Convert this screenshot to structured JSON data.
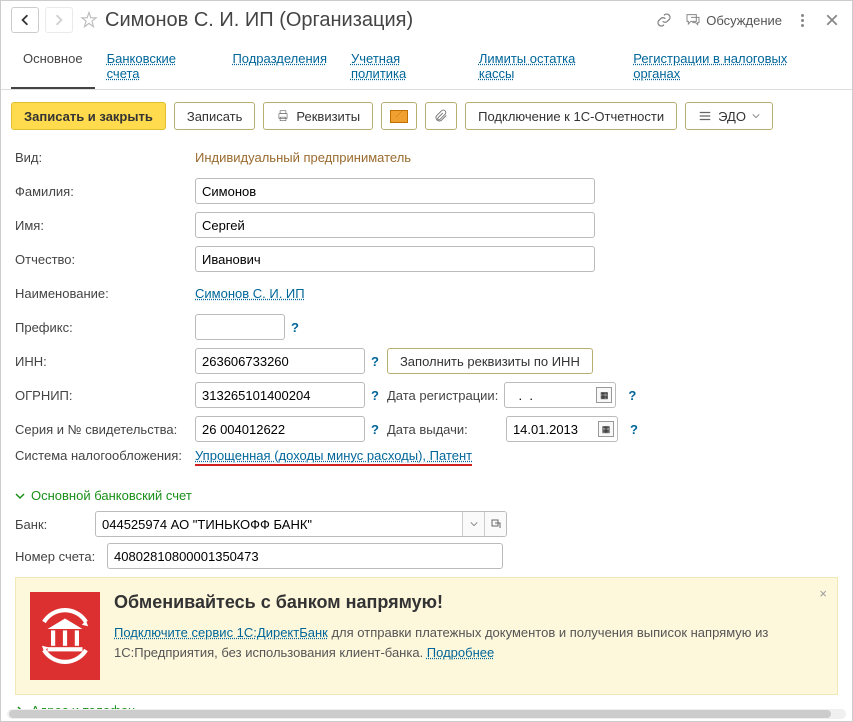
{
  "header": {
    "title": "Симонов С. И. ИП (Организация)",
    "discuss": "Обсуждение"
  },
  "tabs": {
    "main": "Основное",
    "bank": "Банковские счета",
    "dept": "Подразделения",
    "policy": "Учетная политика",
    "limits": "Лимиты остатка кассы",
    "tax": "Регистрации в налоговых органах"
  },
  "toolbar": {
    "save_close": "Записать и закрыть",
    "save": "Записать",
    "requisites": "Реквизиты",
    "connect": "Подключение к 1С-Отчетности",
    "edo": "ЭДО"
  },
  "form": {
    "kind_label": "Вид:",
    "kind_value": "Индивидуальный предприниматель",
    "surname_label": "Фамилия:",
    "surname": "Симонов",
    "name_label": "Имя:",
    "name": "Сергей",
    "patronymic_label": "Отчество:",
    "patronymic": "Иванович",
    "disp_label": "Наименование:",
    "disp_link": "Симонов С. И. ИП",
    "prefix_label": "Префикс:",
    "prefix": "",
    "inn_label": "ИНН:",
    "inn": "263606733260",
    "fill_by_inn": "Заполнить реквизиты по ИНН",
    "ogrnip_label": "ОГРНИП:",
    "ogrnip": "313265101400204",
    "reg_date_label": "Дата регистрации:",
    "reg_date": "  .  .    ",
    "cert_label": "Серия и № свидетельства:",
    "cert": "26 004012622",
    "issue_label": "Дата выдачи:",
    "issue_date": "14.01.2013",
    "tax_sys_label": "Система налогообложения:",
    "tax_sys_link": "Упрощенная (доходы минус расходы), Патент"
  },
  "sections": {
    "bank": "Основной банковский счет",
    "address": "Адрес и телефон"
  },
  "bank": {
    "bank_label": "Банк:",
    "bank_value": "044525974 АО \"ТИНЬКОФФ БАНК\"",
    "acct_label": "Номер счета:",
    "acct_value": "40802810800001350473"
  },
  "promo": {
    "heading": "Обменивайтесь с банком напрямую!",
    "link1": "Подключите сервис 1С:ДиректБанк",
    "text": " для отправки платежных документов и получения выписок напрямую из 1С:Предприятия, без использования клиент-банка. ",
    "more": "Подробнее"
  }
}
